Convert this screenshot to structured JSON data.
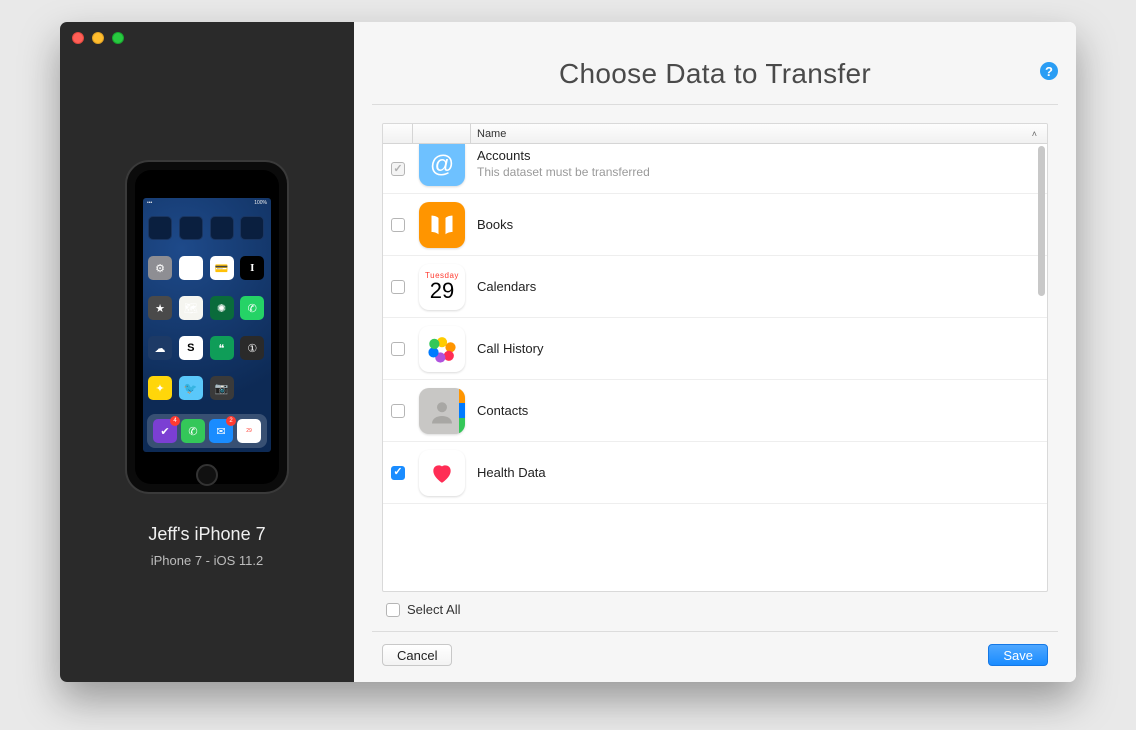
{
  "window": {
    "title": "Choose Data to Transfer",
    "help_tooltip": "?"
  },
  "device": {
    "name": "Jeff's iPhone 7",
    "subtitle": "iPhone 7 - iOS 11.2"
  },
  "table": {
    "header_name": "Name",
    "sort_indicator": "˄",
    "rows": [
      {
        "id": "accounts",
        "label": "Accounts",
        "sub": "This dataset must be transferred",
        "checked": true,
        "disabled": true,
        "icon": "at",
        "color": "#6ec1ff"
      },
      {
        "id": "books",
        "label": "Books",
        "checked": false,
        "disabled": false,
        "icon": "book",
        "color": "#ff9500"
      },
      {
        "id": "calendars",
        "label": "Calendars",
        "checked": false,
        "disabled": false,
        "icon": "calendar",
        "color": "#ffffff",
        "cal_day": "Tuesday",
        "cal_num": "29"
      },
      {
        "id": "callhistory",
        "label": "Call History",
        "checked": false,
        "disabled": false,
        "icon": "photos",
        "color": "#ffffff"
      },
      {
        "id": "contacts",
        "label": "Contacts",
        "checked": false,
        "disabled": false,
        "icon": "contacts",
        "color": "#bfbfbd"
      },
      {
        "id": "health",
        "label": "Health Data",
        "checked": true,
        "disabled": false,
        "icon": "heart",
        "color": "#ffffff"
      }
    ]
  },
  "select_all": {
    "label": "Select All",
    "checked": false
  },
  "buttons": {
    "cancel": "Cancel",
    "save": "Save"
  },
  "phone_apps": {
    "row2": [
      "Settings",
      "Photos",
      "Wallet",
      "Instapaper"
    ],
    "row3": [
      "iTunes",
      "Maps",
      "Starbucks",
      "WhatsApp"
    ],
    "row4": [
      "Dark Sky",
      "Slack",
      "Hangouts",
      "1Password"
    ],
    "row5": [
      "iMovie",
      "Tweetbot",
      "Camera",
      ""
    ],
    "dock": [
      "Reminders",
      "Phone",
      "Mail",
      "Calendar"
    ],
    "badges": {
      "Reminders": "4",
      "Mail": "2"
    }
  }
}
